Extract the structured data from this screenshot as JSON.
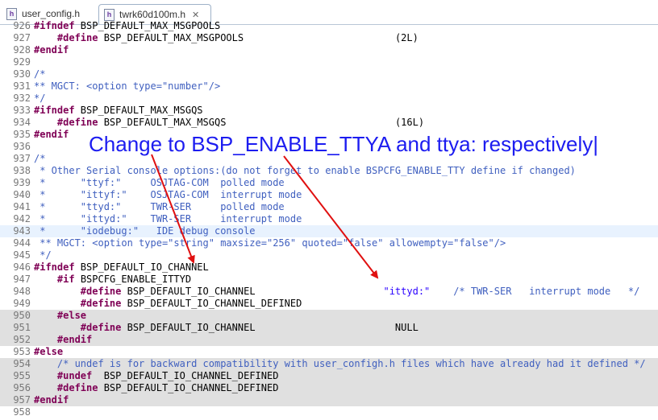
{
  "tabs": [
    {
      "label": "user_config.h",
      "icon": "c-header-file-icon",
      "active": false
    },
    {
      "label": "twrk60d100m.h",
      "icon": "c-header-file-icon",
      "active": true
    }
  ],
  "close_glyph": "✕",
  "annotation": "Change to BSP_ENABLE_TTYA and ttya: respectively|",
  "lines": [
    {
      "n": "926",
      "parts": [
        {
          "t": "#ifndef",
          "c": "k"
        },
        {
          "t": " BSP_DEFAULT_MAX_MSGPOOLS"
        }
      ]
    },
    {
      "n": "927",
      "parts": [
        {
          "t": "    "
        },
        {
          "t": "#define",
          "c": "k"
        },
        {
          "t": " BSP_DEFAULT_MAX_MSGPOOLS                          (2L)"
        }
      ]
    },
    {
      "n": "928",
      "parts": [
        {
          "t": "#endif",
          "c": "k"
        }
      ]
    },
    {
      "n": "929",
      "parts": []
    },
    {
      "n": "930",
      "parts": [
        {
          "t": "/*",
          "c": "c"
        }
      ]
    },
    {
      "n": "931",
      "parts": [
        {
          "t": "** MGCT: <option type=\"number\"/>",
          "c": "c"
        }
      ]
    },
    {
      "n": "932",
      "parts": [
        {
          "t": "*/",
          "c": "c"
        }
      ]
    },
    {
      "n": "933",
      "parts": [
        {
          "t": "#ifndef",
          "c": "k"
        },
        {
          "t": " BSP_DEFAULT_MAX_MSGQS"
        }
      ]
    },
    {
      "n": "934",
      "parts": [
        {
          "t": "    "
        },
        {
          "t": "#define",
          "c": "k"
        },
        {
          "t": " BSP_DEFAULT_MAX_MSGQS                             (16L)"
        }
      ]
    },
    {
      "n": "935",
      "parts": [
        {
          "t": "#endif",
          "c": "k"
        }
      ]
    },
    {
      "n": "936",
      "parts": []
    },
    {
      "n": "937",
      "parts": [
        {
          "t": "/*",
          "c": "c"
        }
      ]
    },
    {
      "n": "938",
      "parts": [
        {
          "t": " * Other Serial console options:(do not forget to enable BSPCFG_ENABLE_TTY define if changed)",
          "c": "c"
        }
      ]
    },
    {
      "n": "939",
      "parts": [
        {
          "t": " *      \"ttyf:\"     OSJTAG-COM  polled mode",
          "c": "c"
        }
      ]
    },
    {
      "n": "940",
      "parts": [
        {
          "t": " *      \"ittyf:\"    OSJTAG-COM  interrupt mode",
          "c": "c"
        }
      ]
    },
    {
      "n": "941",
      "parts": [
        {
          "t": " *      \"ttyd:\"     TWR-SER     polled mode",
          "c": "c"
        }
      ]
    },
    {
      "n": "942",
      "parts": [
        {
          "t": " *      \"ittyd:\"    TWR-SER     interrupt mode",
          "c": "c"
        }
      ]
    },
    {
      "n": "943",
      "parts": [
        {
          "t": " *      \"iodebug:\"   IDE debug console",
          "c": "c"
        }
      ],
      "current": true
    },
    {
      "n": "944",
      "parts": [
        {
          "t": " ** MGCT: <option type=\"string\" maxsize=\"256\" quoted=\"false\" allowempty=\"false\"/>",
          "c": "c"
        }
      ]
    },
    {
      "n": "945",
      "parts": [
        {
          "t": " */",
          "c": "c"
        }
      ]
    },
    {
      "n": "946",
      "parts": [
        {
          "t": "#ifndef",
          "c": "k"
        },
        {
          "t": " BSP_DEFAULT_IO_CHANNEL"
        }
      ]
    },
    {
      "n": "947",
      "parts": [
        {
          "t": "    "
        },
        {
          "t": "#if",
          "c": "k"
        },
        {
          "t": " BSPCFG_ENABLE_ITTYD"
        }
      ]
    },
    {
      "n": "948",
      "parts": [
        {
          "t": "        "
        },
        {
          "t": "#define",
          "c": "k"
        },
        {
          "t": " BSP_DEFAULT_IO_CHANNEL                      "
        },
        {
          "t": "\"ittyd:\"",
          "c": "s"
        },
        {
          "t": "    "
        },
        {
          "t": "/* TWR-SER   interrupt mode   */",
          "c": "c"
        }
      ]
    },
    {
      "n": "949",
      "parts": [
        {
          "t": "        "
        },
        {
          "t": "#define",
          "c": "k"
        },
        {
          "t": " BSP_DEFAULT_IO_CHANNEL_DEFINED"
        }
      ]
    },
    {
      "n": "950",
      "parts": [
        {
          "t": "    "
        },
        {
          "t": "#else",
          "c": "k"
        }
      ],
      "hl": true
    },
    {
      "n": "951",
      "parts": [
        {
          "t": "        "
        },
        {
          "t": "#define",
          "c": "k"
        },
        {
          "t": " BSP_DEFAULT_IO_CHANNEL                        NULL"
        }
      ],
      "hl": true
    },
    {
      "n": "952",
      "parts": [
        {
          "t": "    "
        },
        {
          "t": "#endif",
          "c": "k"
        }
      ],
      "hl": true
    },
    {
      "n": "953",
      "parts": [
        {
          "t": "#else",
          "c": "k"
        }
      ]
    },
    {
      "n": "954",
      "parts": [
        {
          "t": "    "
        },
        {
          "t": "/* undef is for backward compatibility with user_configh.h files which have already had it defined */",
          "c": "c"
        }
      ],
      "hl": true
    },
    {
      "n": "955",
      "parts": [
        {
          "t": "    "
        },
        {
          "t": "#undef",
          "c": "k"
        },
        {
          "t": "  BSP_DEFAULT_IO_CHANNEL_DEFINED"
        }
      ],
      "hl": true
    },
    {
      "n": "956",
      "parts": [
        {
          "t": "    "
        },
        {
          "t": "#define",
          "c": "k"
        },
        {
          "t": " BSP_DEFAULT_IO_CHANNEL_DEFINED"
        }
      ],
      "hl": true
    },
    {
      "n": "957",
      "parts": [
        {
          "t": "#endif",
          "c": "k"
        }
      ],
      "hl": true
    },
    {
      "n": "958",
      "parts": []
    }
  ]
}
